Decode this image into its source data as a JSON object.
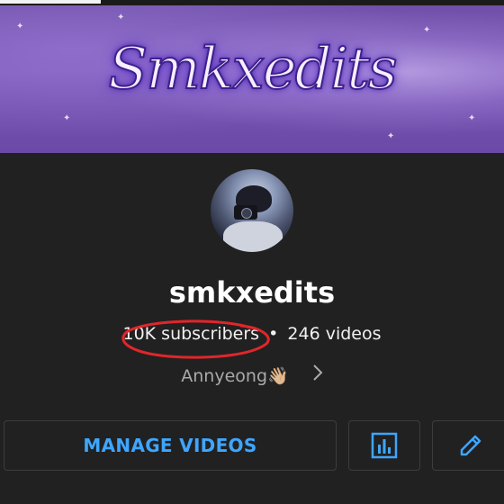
{
  "progress": {
    "fraction": 0.2
  },
  "banner": {
    "logo_text": "Smkxedits"
  },
  "channel": {
    "avatar_icon": "profile-photo",
    "name": "smkxedits",
    "subscribers": "10K subscribers",
    "separator": "•",
    "videos": "246 videos",
    "description": "Annyeong👋🏼",
    "annotation_color": "#e0262b"
  },
  "actions": {
    "manage_label": "MANAGE VIDEOS",
    "analytics_icon": "bar-chart-icon",
    "edit_icon": "pencil-icon",
    "accent_color": "#3ea6ff"
  }
}
